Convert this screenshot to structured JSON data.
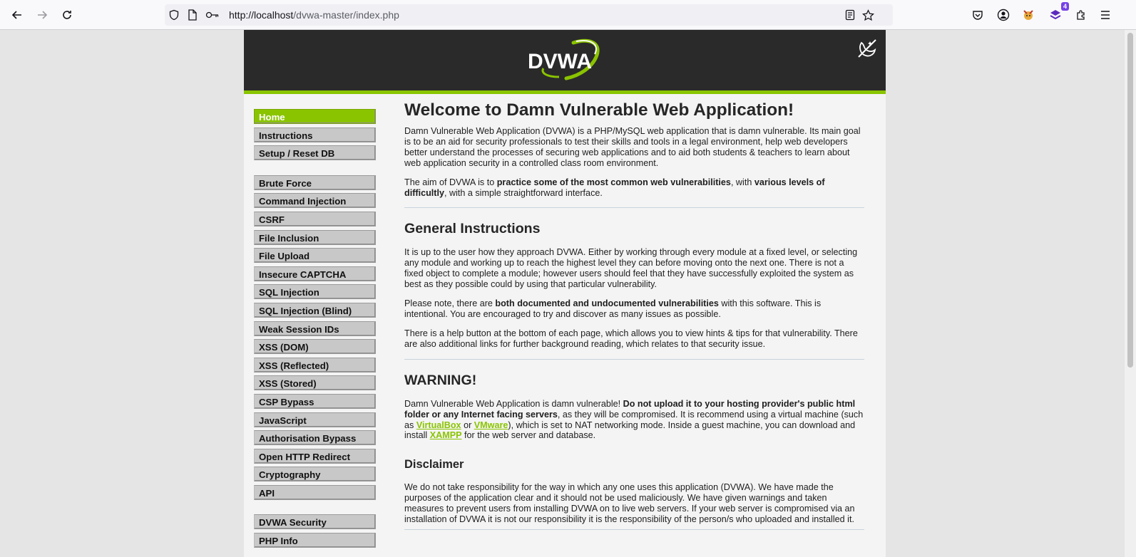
{
  "browser": {
    "url_host": "http://localhost",
    "url_path": "/dvwa-master/index.php",
    "extension_badge": "4"
  },
  "header": {
    "logo_text": "DVWA"
  },
  "menu": {
    "group1": [
      "Home",
      "Instructions",
      "Setup / Reset DB"
    ],
    "group2": [
      "Brute Force",
      "Command Injection",
      "CSRF",
      "File Inclusion",
      "File Upload",
      "Insecure CAPTCHA",
      "SQL Injection",
      "SQL Injection (Blind)",
      "Weak Session IDs",
      "XSS (DOM)",
      "XSS (Reflected)",
      "XSS (Stored)",
      "CSP Bypass",
      "JavaScript",
      "Authorisation Bypass",
      "Open HTTP Redirect",
      "Cryptography",
      "API"
    ],
    "group3": [
      "DVWA Security",
      "PHP Info"
    ]
  },
  "content": {
    "title": "Welcome to Damn Vulnerable Web Application!",
    "intro": "Damn Vulnerable Web Application (DVWA) is a PHP/MySQL web application that is damn vulnerable. Its main goal is to be an aid for security professionals to test their skills and tools in a legal environment, help web developers better understand the processes of securing web applications and to aid both students & teachers to learn about web application security in a controlled class room environment.",
    "aim_pre": "The aim of DVWA is to ",
    "aim_bold1": "practice some of the most common web vulnerabilities",
    "aim_mid": ", with ",
    "aim_bold2": "various levels of difficultly",
    "aim_post": ", with a simple straightforward interface.",
    "instructions_heading": "General Instructions",
    "instructions_p1": "It is up to the user how they approach DVWA. Either by working through every module at a fixed level, or selecting any module and working up to reach the highest level they can before moving onto the next one. There is not a fixed object to complete a module; however users should feel that they have successfully exploited the system as best as they possible could by using that particular vulnerability.",
    "instructions_p2_pre": "Please note, there are ",
    "instructions_p2_bold": "both documented and undocumented vulnerabilities",
    "instructions_p2_post": " with this software. This is intentional. You are encouraged to try and discover as many issues as possible.",
    "instructions_p3": "There is a help button at the bottom of each page, which allows you to view hints & tips for that vulnerability. There are also additional links for further background reading, which relates to that security issue.",
    "warning_heading": "WARNING!",
    "warning_pre": "Damn Vulnerable Web Application is damn vulnerable! ",
    "warning_bold": "Do not upload it to your hosting provider's public html folder or any Internet facing servers",
    "warning_mid1": ", as they will be compromised. It is recommend using a virtual machine (such as ",
    "warning_link1": "VirtualBox",
    "warning_mid2": " or ",
    "warning_link2": "VMware",
    "warning_mid3": "), which is set to NAT networking mode. Inside a guest machine, you can download and install ",
    "warning_link3": "XAMPP",
    "warning_post": " for the web server and database.",
    "disclaimer_heading": "Disclaimer",
    "disclaimer_text": "We do not take responsibility for the way in which any one uses this application (DVWA). We have made the purposes of the application clear and it should not be used maliciously. We have given warnings and taken measures to prevent users from installing DVWA on to live web servers. If your web server is compromised via an installation of DVWA it is not our responsibility it is the responsibility of the person/s who uploaded and installed it."
  },
  "colors": {
    "accent": "#8ac400",
    "header_bg": "#2a2a2a"
  }
}
